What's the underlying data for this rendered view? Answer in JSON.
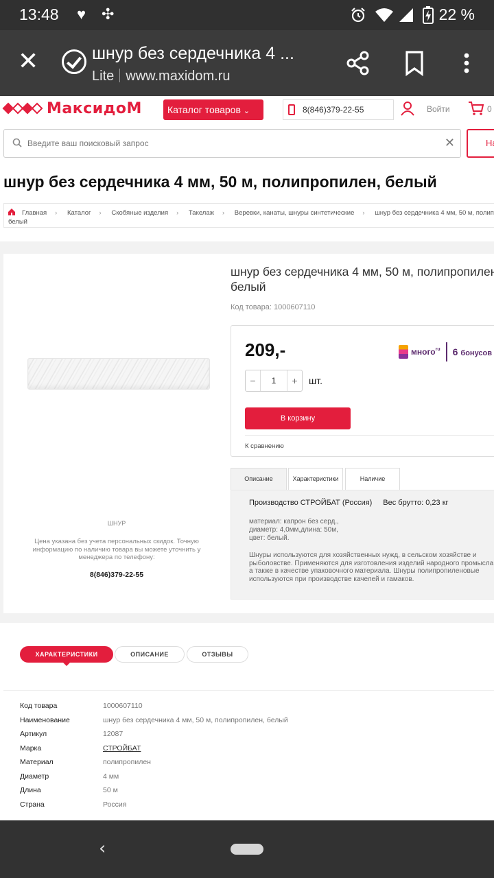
{
  "status_bar": {
    "time": "13:48",
    "battery": "22 %"
  },
  "browser": {
    "title": "шнур без сердечника 4 ...",
    "mode": "Lite",
    "domain": "www.maxidom.ru"
  },
  "header": {
    "logo_text": "МаксидоМ",
    "catalog_label": "Каталог товаров",
    "phone": "8(846)379-22-55",
    "login_label": "Войти",
    "cart_count": "0"
  },
  "search": {
    "placeholder": "Введите ваш поисковый запрос",
    "button_label": "На"
  },
  "product": {
    "h1": "шнур без сердечника 4 мм, 50 м, полипропилен, белый",
    "title": "шнур без сердечника 4 мм, 50 м, полипропилен, белый",
    "code": "Код товара: 1000607110",
    "price": "209,-",
    "quantity": "1",
    "unit": "шт.",
    "add_to_cart": "В корзину",
    "compare": "К сравнению",
    "image_caption": "ШНУР",
    "price_note": "Цена указана без учета персональных скидок. Точную информацию по наличию товара вы можете уточнить у менеджера по телефону:",
    "note_phone": "8(846)379-22-55"
  },
  "mnogo": {
    "brand": "много",
    "suffix": "ru",
    "bonus_count": "6",
    "bonus_label": "бонусов"
  },
  "breadcrumbs": [
    "Главная",
    "Каталог",
    "Скобяные изделия",
    "Такелаж",
    "Веревки, канаты, шнуры синтетические",
    "шнур без сердечника 4 мм, 50 м, полипропилен,"
  ],
  "breadcrumb_tail": "белый",
  "detail_tabs": [
    "Описание",
    "Характеристики",
    "Наличие"
  ],
  "detail": {
    "manufacturer": "Производство СТРОЙБАТ (Россия)",
    "gross_weight": "Вес брутто: 0,23 кг",
    "materials": "материал: капрон без серд.,\nдиаметр: 4,0мм,длина: 50м,\nцвет: белый.",
    "description": "Шнуры используются для хозяйственных нужд, в сельском хозяйстве и рыболовстве. Применяются для изготовления изделий народного промысла, а также в качестве упаковочного материала. Шнуры полипропиленовые используются при производстве качелей и гамаков."
  },
  "page_tabs": [
    "ХАРАКТЕРИСТИКИ",
    "ОПИСАНИЕ",
    "ОТЗЫВЫ"
  ],
  "specs": [
    {
      "key": "Код товара",
      "value": "1000607110"
    },
    {
      "key": "Наименование",
      "value": "шнур без сердечника 4 мм, 50 м, полипропилен, белый"
    },
    {
      "key": "Артикул",
      "value": "12087"
    },
    {
      "key": "Марка",
      "value": "СТРОЙБАТ"
    },
    {
      "key": "Материал",
      "value": "полипропилен"
    },
    {
      "key": "Диаметр",
      "value": "4 мм"
    },
    {
      "key": "Длина",
      "value": "50 м"
    },
    {
      "key": "Страна",
      "value": "Россия"
    }
  ],
  "colors": {
    "brand_red": "#e31e3d",
    "chrome_dark": "#3b3b3b",
    "band_gray": "#f2f2f2"
  },
  "icons": [
    "heart-pulse-icon",
    "pinwheel-icon",
    "alarm-icon",
    "wifi-icon",
    "signal-icon",
    "battery-icon",
    "close-icon",
    "lite-mode-icon",
    "share-icon",
    "bookmark-icon",
    "more-icon",
    "phone-icon",
    "user-icon",
    "cart-icon",
    "search-icon",
    "clear-icon",
    "home-icon",
    "back-icon"
  ]
}
